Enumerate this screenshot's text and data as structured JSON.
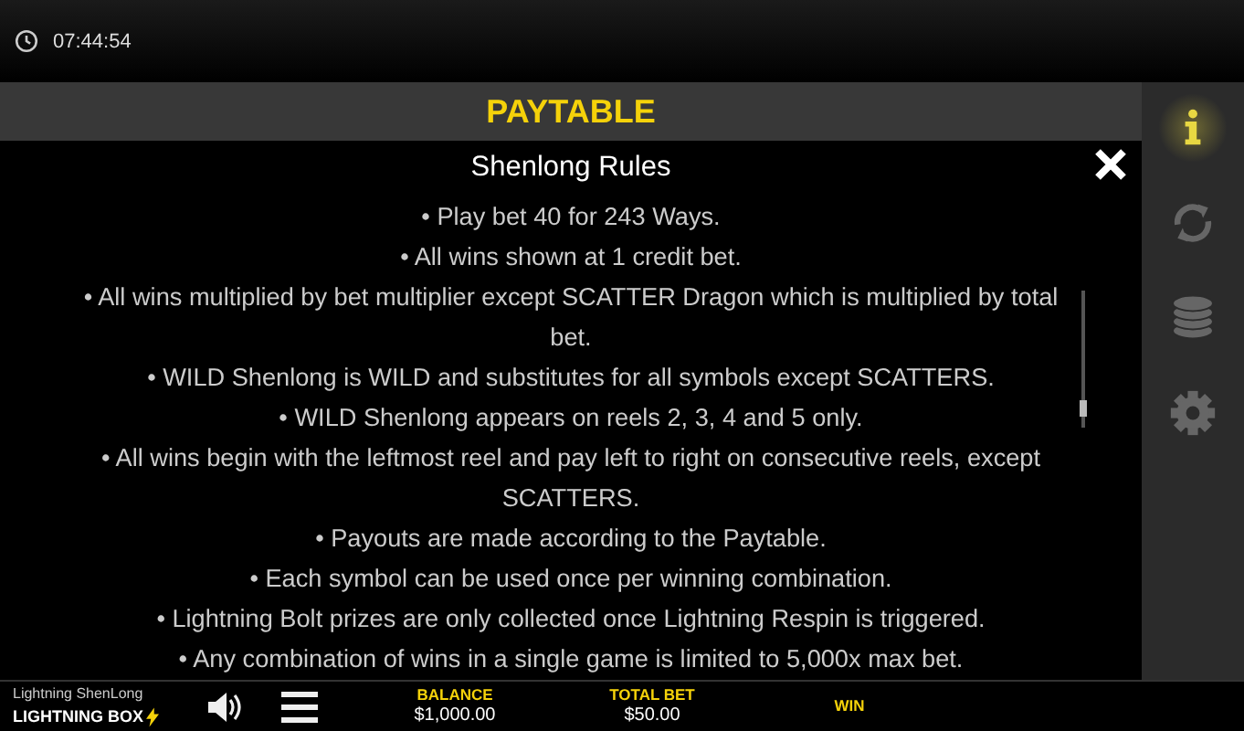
{
  "status_bar": {
    "time": "07:44:54"
  },
  "header": {
    "title": "PAYTABLE"
  },
  "rules": {
    "title": "Shenlong Rules",
    "items": [
      "• Play bet 40 for 243 Ways.",
      "• All wins shown at 1 credit bet.",
      "• All wins multiplied by bet multiplier except SCATTER Dragon which is multiplied by total bet.",
      "• WILD Shenlong is WILD and substitutes for all symbols except SCATTERS.",
      "• WILD Shenlong appears on reels 2, 3, 4 and 5 only.",
      "• All wins begin with the leftmost reel and pay left to right on consecutive reels, except SCATTERS.",
      "• Payouts are made according to the Paytable.",
      "• Each symbol can be used once per winning combination.",
      "• Lightning Bolt prizes are only collected once Lightning Respin is triggered.",
      "• Any combination of wins in a single game is limited to 5,000x max bet."
    ]
  },
  "sidebar": {
    "items": [
      {
        "kind": "info",
        "selected": true
      },
      {
        "kind": "refresh",
        "selected": false
      },
      {
        "kind": "coins",
        "selected": false
      },
      {
        "kind": "settings",
        "selected": false
      }
    ]
  },
  "footer": {
    "game_name": "Lightning ShenLong",
    "brand": "LIGHTNING BOX",
    "stats": [
      {
        "label": "BALANCE",
        "value": "$1,000.00"
      },
      {
        "label": "TOTAL BET",
        "value": "$50.00"
      },
      {
        "label": "WIN"
      }
    ]
  }
}
